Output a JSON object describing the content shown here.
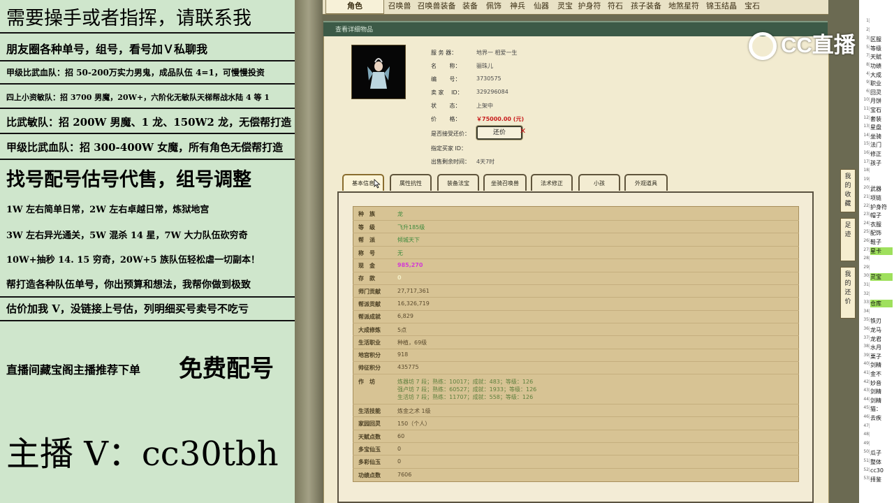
{
  "overlay": {
    "l1": "需要操手或者指挥，请联系我",
    "l2": "朋友圈各种单号，组号，看号加Ｖ私聊我",
    "l3": "甲级比武血队：招 50-200万实力男鬼，成品队伍 4=1，可慢慢投资",
    "l4": "四上小资敏队：招 3700 男魔，20W+，六阶化无敏队天梯帮战水陆 4 等 1",
    "l5": "比武敏队：招 200W 男魔、1 龙、150W2 龙，无偿帮打造",
    "l6": "甲级比武血队：招 300-400W 女魔，所有角色无偿帮打造",
    "l7": "找号配号估号代售，组号调整",
    "l8": "1W 左右简单日常，2W 左右卓越日常，炼狱地宫",
    "l9": "3W 左右异光通关，5W 混杀 14 星，7W 大力队伍砍穷奇",
    "l10": "10W+抽秒 14. 15 穷奇，20W+5 族队伍轻松虐一切副本！",
    "l11": "帮打造各种队伍单号，你出预算和想法，我帮你做到极致",
    "l12": "估价加我 V，没链接上号估，列明细买号卖号不吃亏",
    "l13a": "直播间藏宝阁主播推荐下单",
    "l13b": "免费配号",
    "l14": "主播 V：cc30tbh"
  },
  "topnav": {
    "tabs": [
      "角色",
      "召唤兽",
      "召唤兽装备",
      "装备",
      "佩饰",
      "神兵",
      "仙器",
      "灵宝",
      "护身符",
      "符石",
      "孩子装备",
      "地煞星符",
      "锦玉结晶",
      "宝石"
    ]
  },
  "panel": {
    "title": "查看详细物品",
    "fields": [
      {
        "k": "服 务 器：",
        "v": "地界一 相爱一生"
      },
      {
        "k": "名 　　称：",
        "v": "骊珠儿"
      },
      {
        "k": "编 　　号：",
        "v": "3730575"
      },
      {
        "k": "卖 家 　ID：",
        "v": "329296084"
      },
      {
        "k": "状 　　态：",
        "v": "上架中"
      },
      {
        "k": "价 　　格：",
        "v": "￥75000.00 (元)"
      },
      {
        "k": "是否接受还价：",
        "v": ""
      },
      {
        "k": "指定买家 ID：",
        "v": ""
      },
      {
        "k": "出售剩余时间：",
        "v": "4天7时"
      }
    ],
    "counter_label": "还价",
    "close_symbol": "✕"
  },
  "detail_tabs": [
    "基本信息",
    "属性抗性",
    "装备法宝",
    "坐骑召唤兽",
    "法术修正",
    "小孩",
    "外观道具"
  ],
  "basic": [
    {
      "k": "种　族",
      "v": "龙"
    },
    {
      "k": "等　级",
      "v": "飞升185级"
    },
    {
      "k": "帮　派",
      "v": "倾城天下"
    },
    {
      "k": "称　号",
      "v": "无"
    },
    {
      "k": "现　金",
      "v": "985,270"
    },
    {
      "k": "存　款",
      "v": "0"
    },
    {
      "k": "师门贡献",
      "v": "27,717,361"
    },
    {
      "k": "帮派贡献",
      "v": "16,326,719"
    },
    {
      "k": "帮派成就",
      "v": "6,829"
    },
    {
      "k": "大成修炼",
      "v": "5点"
    },
    {
      "k": "生活职业",
      "v": "种植，69级"
    },
    {
      "k": "地宫积分",
      "v": "918"
    },
    {
      "k": "帅征积分",
      "v": "435775"
    }
  ],
  "workshop": {
    "label": "作　坊",
    "lines": [
      "炼器坊 7 段；熟练：10017；成就：483；等级：126",
      "强卢坊 7 段；熟练：60527；成就：1933；等级：126",
      "生活坊 7 段；熟练：11707；成就：558；等级：126"
    ]
  },
  "basic2": [
    {
      "k": "生活技能",
      "v": "炼金之术 1级"
    },
    {
      "k": "家园回灵",
      "v": "150（个人）"
    },
    {
      "k": "天赋点数",
      "v": "60"
    },
    {
      "k": "多宝仙玉",
      "v": "0"
    },
    {
      "k": "多彩仙玉",
      "v": "0"
    },
    {
      "k": "功绩点数",
      "v": "7606"
    }
  ],
  "sidebar": {
    "fav": "我的收藏",
    "footprint": "足迹",
    "my_counter": "我的还价"
  },
  "watermark": "CC直播",
  "sheet": {
    "rows": [
      {
        "n": "1",
        "c": ""
      },
      {
        "n": "2",
        "c": ""
      },
      {
        "n": "3",
        "c": "区服"
      },
      {
        "n": "5",
        "c": "等级"
      },
      {
        "n": "7",
        "c": "天赋"
      },
      {
        "n": "8",
        "c": "功绩"
      },
      {
        "n": "4",
        "c": "大成"
      },
      {
        "n": "9",
        "c": "职业"
      },
      {
        "n": "6",
        "c": "回灵"
      },
      {
        "n": "10",
        "c": "月饼"
      },
      {
        "n": "11",
        "c": "宝石"
      },
      {
        "n": "12",
        "c": "套装"
      },
      {
        "n": "13",
        "c": "星盘"
      },
      {
        "n": "14",
        "c": "坐骑"
      },
      {
        "n": "15",
        "c": "法门"
      },
      {
        "n": "16",
        "c": "修正"
      },
      {
        "n": "17",
        "c": "孩子"
      },
      {
        "n": "18",
        "c": ""
      },
      {
        "n": "19",
        "c": ""
      },
      {
        "n": "20",
        "c": "武器"
      },
      {
        "n": "21",
        "c": "项链"
      },
      {
        "n": "22",
        "c": "护身符"
      },
      {
        "n": "23",
        "c": "帽子"
      },
      {
        "n": "24",
        "c": "衣服"
      },
      {
        "n": "25",
        "c": "配饰"
      },
      {
        "n": "26",
        "c": "鞋子"
      },
      {
        "n": "27",
        "c": "星卡"
      },
      {
        "n": "28",
        "c": ""
      },
      {
        "n": "29",
        "c": ""
      },
      {
        "n": "30",
        "c": "灵宝"
      },
      {
        "n": "31",
        "c": ""
      },
      {
        "n": "32",
        "c": ""
      },
      {
        "n": "33",
        "c": "仓库"
      },
      {
        "n": "34",
        "c": ""
      },
      {
        "n": "35",
        "c": "铁刃"
      },
      {
        "n": "36",
        "c": "龙马"
      },
      {
        "n": "37",
        "c": "龙君"
      },
      {
        "n": "38",
        "c": "水月"
      },
      {
        "n": "39",
        "c": "栗子"
      },
      {
        "n": "40",
        "c": "剑精"
      },
      {
        "n": "41",
        "c": "金不"
      },
      {
        "n": "42",
        "c": "妙音"
      },
      {
        "n": "43",
        "c": "剑精"
      },
      {
        "n": "44",
        "c": "剑精"
      },
      {
        "n": "45",
        "c": "猫："
      },
      {
        "n": "46",
        "c": "去疾"
      },
      {
        "n": "47",
        "c": ""
      },
      {
        "n": "48",
        "c": ""
      },
      {
        "n": "49",
        "c": ""
      },
      {
        "n": "50",
        "c": "瓜子"
      },
      {
        "n": "51",
        "c": "整体"
      },
      {
        "n": "52",
        "c": "cc30"
      },
      {
        "n": "53",
        "c": "择鉴"
      }
    ]
  }
}
